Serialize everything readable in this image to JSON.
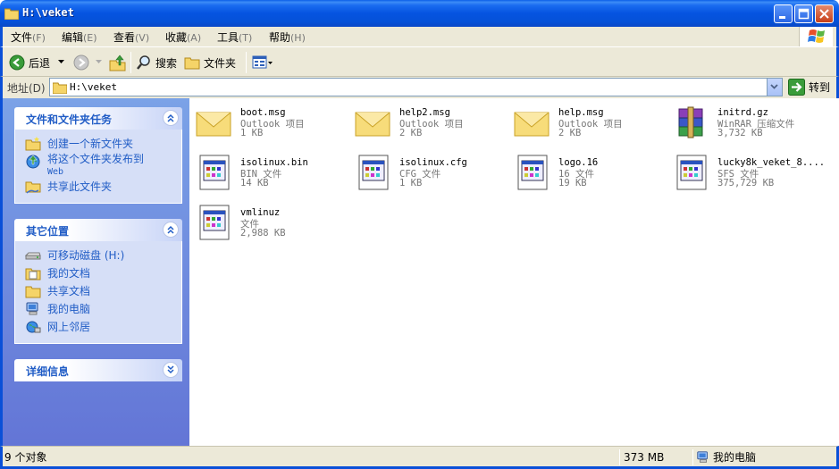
{
  "window": {
    "title": "H:\\veket"
  },
  "menu": {
    "items": [
      {
        "label": "文件",
        "key": "(F)"
      },
      {
        "label": "编辑",
        "key": "(E)"
      },
      {
        "label": "查看",
        "key": "(V)"
      },
      {
        "label": "收藏",
        "key": "(A)"
      },
      {
        "label": "工具",
        "key": "(T)"
      },
      {
        "label": "帮助",
        "key": "(H)"
      }
    ]
  },
  "toolbar": {
    "back": "后退",
    "search": "搜索",
    "folders": "文件夹"
  },
  "address": {
    "label": "地址(D)",
    "value": "H:\\veket",
    "go": "转到"
  },
  "tasks": {
    "title": "文件和文件夹任务",
    "items": [
      {
        "label": "创建一个新文件夹"
      },
      {
        "label": "将这个文件夹发布到",
        "label2": "Web"
      },
      {
        "label": "共享此文件夹"
      }
    ]
  },
  "places": {
    "title": "其它位置",
    "items": [
      {
        "label": "可移动磁盘 (H:)"
      },
      {
        "label": "我的文档"
      },
      {
        "label": "共享文档"
      },
      {
        "label": "我的电脑"
      },
      {
        "label": "网上邻居"
      }
    ]
  },
  "details": {
    "title": "详细信息"
  },
  "files": [
    {
      "name": "boot.msg",
      "type": "Outlook 项目",
      "size": "1 KB",
      "icon": "envelope-icon"
    },
    {
      "name": "help2.msg",
      "type": "Outlook 项目",
      "size": "2 KB",
      "icon": "envelope-icon"
    },
    {
      "name": "help.msg",
      "type": "Outlook 项目",
      "size": "2 KB",
      "icon": "envelope-icon"
    },
    {
      "name": "initrd.gz",
      "type": "WinRAR 压缩文件",
      "size": "3,732 KB",
      "icon": "winrar-icon"
    },
    {
      "name": "isolinux.bin",
      "type": "BIN 文件",
      "size": "14 KB",
      "icon": "generic-file-icon"
    },
    {
      "name": "isolinux.cfg",
      "type": "CFG 文件",
      "size": "1 KB",
      "icon": "generic-file-icon"
    },
    {
      "name": "logo.16",
      "type": "16 文件",
      "size": "19 KB",
      "icon": "generic-file-icon"
    },
    {
      "name": "lucky8k_veket_8....",
      "type": "SFS 文件",
      "size": "375,729 KB",
      "icon": "generic-file-icon"
    },
    {
      "name": "vmlinuz",
      "type": "文件",
      "size": "2,988 KB",
      "icon": "generic-file-icon"
    }
  ],
  "status": {
    "count": "9 个对象",
    "size": "373 MB",
    "location": "我的电脑"
  }
}
